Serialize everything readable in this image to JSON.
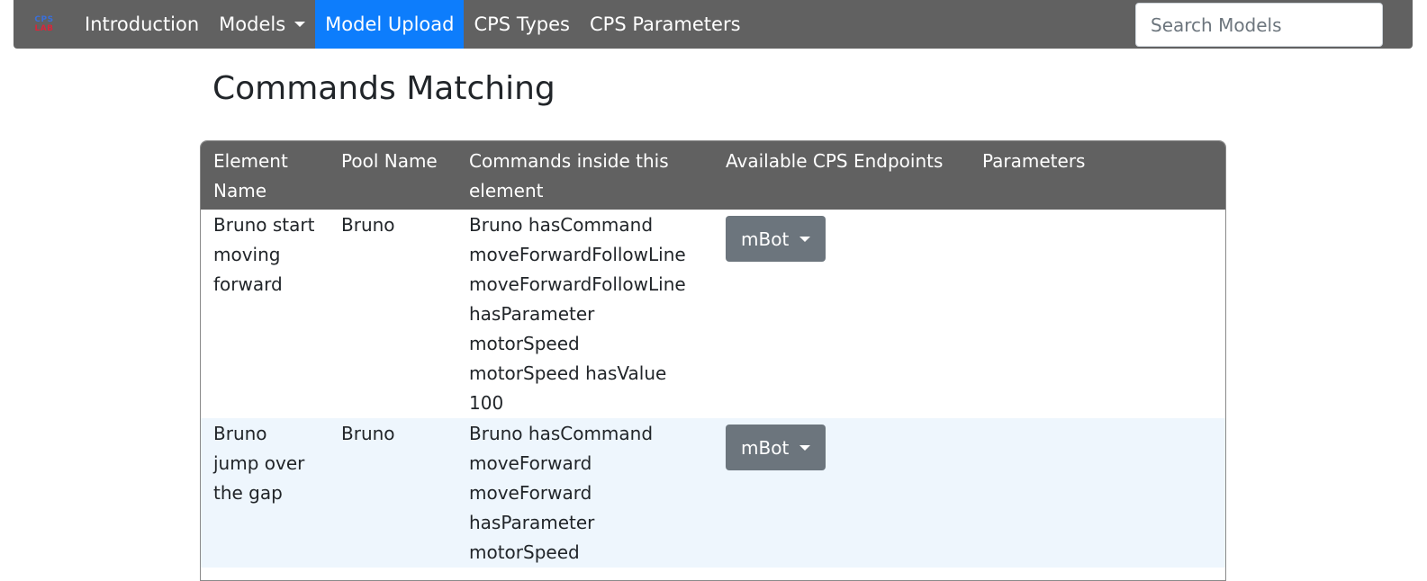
{
  "navbar": {
    "brand": {
      "line1": "CPS",
      "line2": "LAB"
    },
    "items": [
      {
        "label": "Introduction",
        "active": false,
        "dropdown": false
      },
      {
        "label": "Models",
        "active": false,
        "dropdown": true
      },
      {
        "label": "Model Upload",
        "active": true,
        "dropdown": false
      },
      {
        "label": "CPS Types",
        "active": false,
        "dropdown": false
      },
      {
        "label": "CPS Parameters",
        "active": false,
        "dropdown": false
      }
    ],
    "search_placeholder": "Search Models"
  },
  "page": {
    "title": "Commands Matching"
  },
  "table": {
    "headers": [
      "Element Name",
      "Pool Name",
      "Commands inside this element",
      "Available CPS Endpoints",
      "Parameters"
    ],
    "rows": [
      {
        "element_name": "Bruno start moving forward",
        "pool_name": "Bruno",
        "commands": [
          "Bruno hasCommand moveForwardFollowLine",
          "moveForwardFollowLine hasParameter motorSpeed",
          "motorSpeed hasValue 100"
        ],
        "endpoint": "mBot",
        "parameters": ""
      },
      {
        "element_name": "Bruno jump over the gap",
        "pool_name": "Bruno",
        "commands": [
          "Bruno hasCommand moveForward",
          "moveForward hasParameter motorSpeed"
        ],
        "endpoint": "mBot",
        "parameters": ""
      }
    ]
  },
  "colors": {
    "navbar_bg": "#616161",
    "active_nav_bg": "#0d7dfc",
    "table_header_bg": "#616161",
    "dropdown_bg": "#6c757d",
    "alt_row_bg": "#eef6fd"
  }
}
